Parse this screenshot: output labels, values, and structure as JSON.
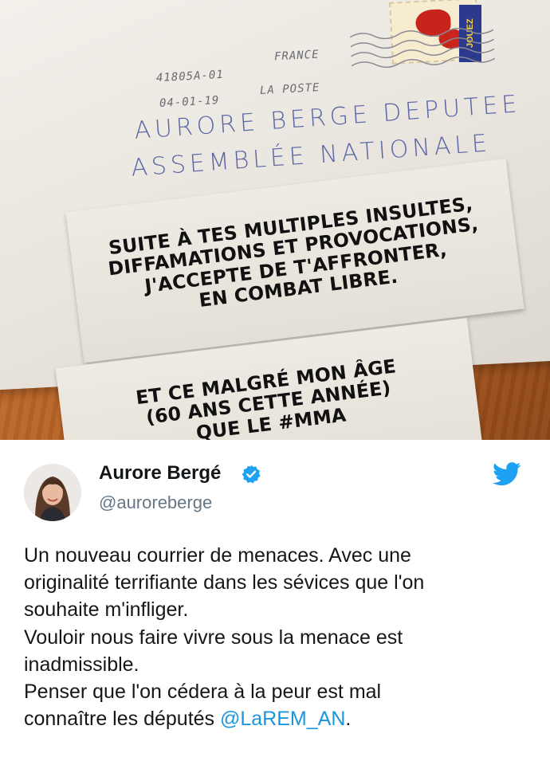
{
  "photo": {
    "postmark": {
      "code": "41805A-01",
      "country": "FRANCE",
      "date": "04-01-19",
      "operator": "LA POSTE"
    },
    "stamp_label": "JOUEZ",
    "address": {
      "line1": "AURORE BERGE DEPUTEE",
      "line2": "ASSEMBLÉE NATIONALE"
    },
    "note1_lines": [
      "SUITE À TES MULTIPLES INSULTES,",
      "DIFFAMATIONS ET PROVOCATIONS,",
      "J'ACCEPTE DE T'AFFRONTER,",
      "EN COMBAT LIBRE."
    ],
    "note2_lines": [
      "ET CE MALGRÉ MON ÂGE",
      "(60 ANS CETTE ANNÉE)",
      "QUE LE #MMA"
    ]
  },
  "tweet": {
    "display_name": "Aurore Bergé",
    "handle": "@auroreberge",
    "verified": true,
    "icons": {
      "verified": "verified-badge-icon",
      "brand": "twitter-bird-icon"
    },
    "colors": {
      "brand": "#1da1f2",
      "mention": "#1b95e0",
      "handle": "#657786"
    },
    "body": {
      "line1": "Un nouveau courrier de menaces. Avec une",
      "line2": "originalité terrifiante dans les sévices que l'on",
      "line3": "souhaite m'infliger.",
      "line4": "Vouloir nous faire vivre sous la menace est",
      "line5": "inadmissible.",
      "line6": "Penser que l'on cédera à la peur est mal",
      "line7_text": "connaître les députés ",
      "line7_mention": "@LaREM_AN",
      "line7_end": "."
    }
  }
}
